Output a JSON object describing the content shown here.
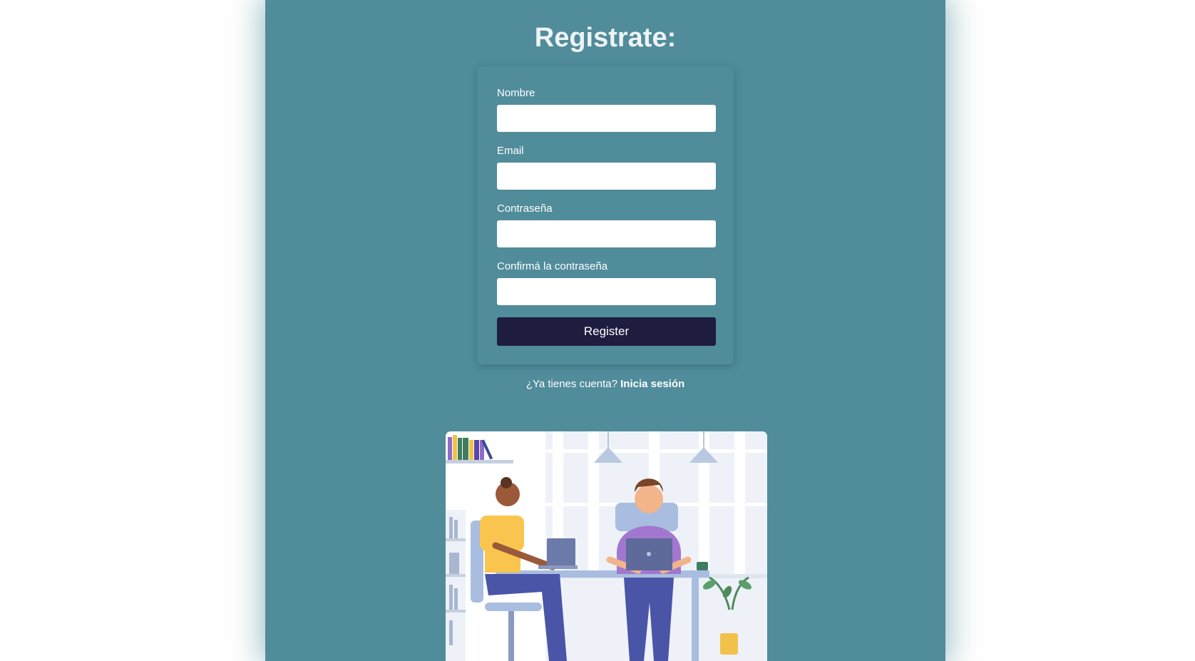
{
  "form": {
    "title": "Registrate:",
    "fields": [
      {
        "label": "Nombre",
        "value": "",
        "placeholder": ""
      },
      {
        "label": "Email",
        "value": "",
        "placeholder": ""
      },
      {
        "label": "Contraseña",
        "value": "",
        "placeholder": ""
      },
      {
        "label": "Confirmá la contraseña",
        "value": "",
        "placeholder": ""
      }
    ],
    "submit_label": "Register"
  },
  "login_prompt": {
    "text": "¿Ya tienes cuenta?",
    "link_label": "Inicia sesión"
  },
  "colors": {
    "panel_background": "#518c9b",
    "button_background": "#1e1c3f",
    "text": "#ffffff"
  },
  "illustration": {
    "description_icon": "coworking-illustration"
  }
}
